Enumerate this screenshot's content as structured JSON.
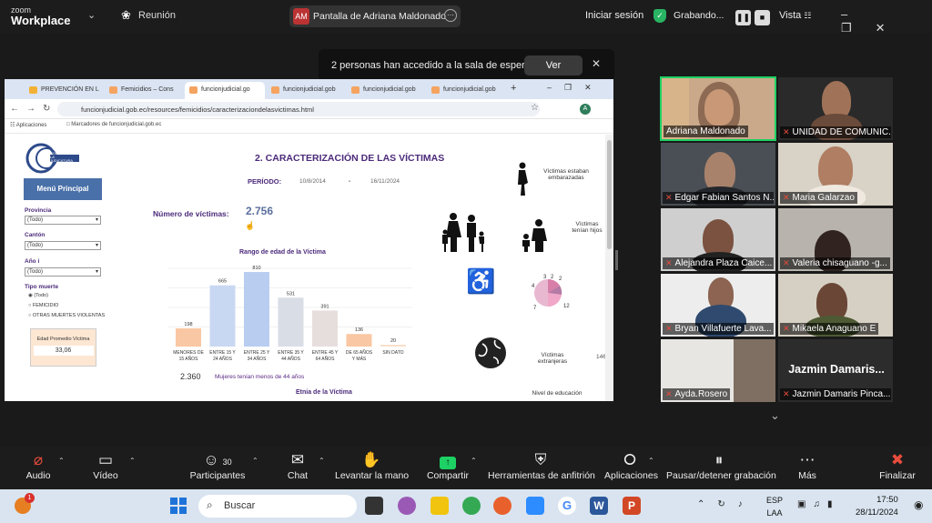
{
  "app": {
    "brand_top": "zoom",
    "brand_bottom": "Workplace",
    "meeting_label": "Reunión"
  },
  "share": {
    "avatar": "AM",
    "title": "Pantalla de Adriana Maldonado"
  },
  "header": {
    "signin": "Iniciar sesión",
    "recording": "Grabando...",
    "view": "Vista"
  },
  "waiting": {
    "text": "2 personas han accedido a la sala de espera",
    "button": "Ver"
  },
  "browser": {
    "tabs": [
      "PREVENCIÓN EN L",
      "Femicidios – Cons",
      "funcionjudicial.go",
      "funcionjudicial.gob",
      "funcionjudicial.gob",
      "funcionjudicial.gob"
    ],
    "url": "funcionjudicial.gob.ec/resources/femicidios/caracterizaciondelasvictimas.html",
    "bookmarks": [
      "Aplicaciones",
      "Marcadores de funcionjudicial.gob.ec"
    ]
  },
  "dashboard": {
    "logo_text": "CONSEJO DE LA JUDICATURA",
    "menu": "Menú Principal",
    "title": "2. CARACTERIZACIÓN DE LAS VÍCTIMAS",
    "periodo_label": "PERÍODO:",
    "date_from": "10/8/2014",
    "date_sep": "-",
    "date_to": "16/11/2024",
    "victims_label": "Número de víctimas:",
    "victims_value": "2.756",
    "filters": [
      {
        "label": "Provincia",
        "value": "(Todo)"
      },
      {
        "label": "Cantón",
        "value": "(Todo)"
      },
      {
        "label": "Año i",
        "value": "(Todo)"
      }
    ],
    "tipo_label": "Tipo muerte",
    "tipo_options": [
      "(Todo)",
      "FEMICIDIO",
      "OTRAS MUERTES VIOLENTAS"
    ],
    "edad_title": "Edad Promedio Víctima",
    "edad_value": "33,06",
    "women_value": "2.360",
    "women_label": "Mujeres tenían menos de 44 años",
    "etnia": "Etnia de la Víctima",
    "right_labels": [
      "Víctimas estaban embarazadas",
      "Víctimas tenían hijos",
      "Víctimas extranjeras",
      "Nivel de educación"
    ],
    "right_numbers": [
      "146"
    ],
    "pie_labels": [
      "3",
      "2",
      "2",
      "4",
      "7",
      "12"
    ]
  },
  "chart_data": {
    "type": "bar",
    "title": "Rango de edad de la Víctima",
    "categories": [
      "MENORES DE 15 AÑOS",
      "ENTRE 15 Y 24 AÑOS",
      "ENTRE 25 Y 34 AÑOS",
      "ENTRE 35 Y 44 AÑOS",
      "ENTRE 45 Y 64 AÑOS",
      "DE 65 AÑOS Y MÁS",
      "SIN DATO"
    ],
    "values": [
      198,
      665,
      810,
      531,
      391,
      136,
      20
    ],
    "colors": [
      "#f9c7a3",
      "#c9d8f2",
      "#b9cdf0",
      "#d9dde6",
      "#e6dedd",
      "#f9c7a3",
      "#f9e0cc"
    ],
    "ylim": [
      0,
      850
    ]
  },
  "participants": [
    {
      "name": "Adriana Maldonado",
      "muted": false,
      "speaking": true
    },
    {
      "name": "UNIDAD DE COMUNIC...",
      "muted": true
    },
    {
      "name": "Edgar Fabian Santos N...",
      "muted": true
    },
    {
      "name": "Maria Galarzao",
      "muted": true
    },
    {
      "name": "Alejandra Plaza Caice...",
      "muted": true
    },
    {
      "name": "Valeria chisaguano -g...",
      "muted": true
    },
    {
      "name": "Bryan Villafuerte Lava...",
      "muted": true
    },
    {
      "name": "Mikaela Anaguano E",
      "muted": true
    },
    {
      "name": "Ayda.Rosero",
      "muted": true
    },
    {
      "name": "Jazmin Damaris Pinca...",
      "muted": true
    }
  ],
  "jazmin_big": "Jazmin Damaris...",
  "toolbar": {
    "audio": "Audio",
    "video": "Vídeo",
    "participants": "Participantes",
    "participants_count": "30",
    "chat": "Chat",
    "raise_hand": "Levantar la mano",
    "share": "Compartir",
    "host_tools": "Herramientas de anfitrión",
    "apps": "Aplicaciones",
    "pause_rec": "Pausar/detener grabación",
    "more": "Más",
    "end": "Finalizar"
  },
  "taskbar": {
    "search": "Buscar",
    "lang1": "ESP",
    "lang2": "LAA",
    "time": "17:50",
    "date": "28/11/2024",
    "badge": "1"
  }
}
